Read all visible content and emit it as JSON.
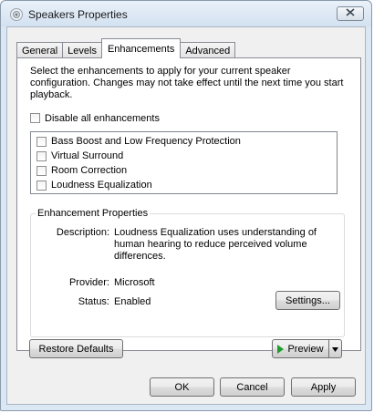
{
  "window": {
    "title": "Speakers Properties"
  },
  "tabs": [
    {
      "label": "General"
    },
    {
      "label": "Levels"
    },
    {
      "label": "Enhancements"
    },
    {
      "label": "Advanced"
    }
  ],
  "enhancements": {
    "intro": "Select the enhancements to apply for your current speaker configuration. Changes may not take effect until the next time you start playback.",
    "disable_all_label": "Disable all enhancements",
    "items": [
      {
        "label": "Bass Boost and Low Frequency Protection"
      },
      {
        "label": "Virtual Surround"
      },
      {
        "label": "Room Correction"
      },
      {
        "label": "Loudness Equalization"
      }
    ]
  },
  "properties": {
    "title": "Enhancement Properties",
    "description_label": "Description:",
    "description_value": "Loudness Equalization uses understanding of human hearing to reduce perceived volume differences.",
    "provider_label": "Provider:",
    "provider_value": "Microsoft",
    "status_label": "Status:",
    "status_value": "Enabled",
    "settings_label": "Settings..."
  },
  "buttons": {
    "restore_defaults": "Restore Defaults",
    "preview": "Preview",
    "ok": "OK",
    "cancel": "Cancel",
    "apply": "Apply"
  },
  "icons": {
    "app": "speaker-icon",
    "close": "close-icon",
    "play": "play-icon",
    "dropdown": "dropdown-arrow-icon"
  },
  "colors": {
    "play_icon": "#1f9d2b",
    "title_bar": "#d3e1f0"
  }
}
